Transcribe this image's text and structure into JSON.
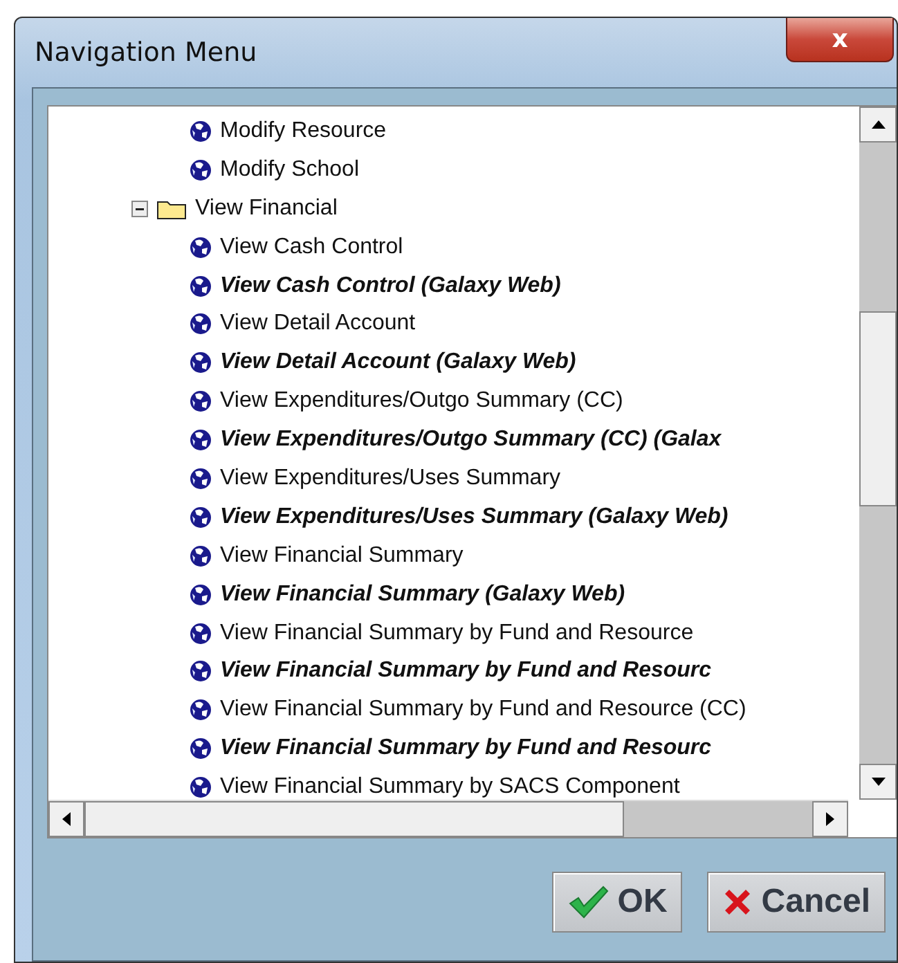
{
  "window": {
    "title": "Navigation Menu",
    "close_label": "x"
  },
  "tree": [
    {
      "children": [
        {
          "label": "Modify Resource",
          "emphasized": false
        },
        {
          "label": "Modify School",
          "emphasized": false
        }
      ]
    },
    {
      "label": "View Financial",
      "kind": "folder",
      "expanded": true,
      "children": [
        {
          "label": "View Cash Control",
          "emphasized": false
        },
        {
          "label": "View Cash Control (Galaxy Web)",
          "emphasized": true
        },
        {
          "label": "View Detail Account",
          "emphasized": false
        },
        {
          "label": "View Detail Account (Galaxy Web)",
          "emphasized": true
        },
        {
          "label": "View Expenditures/Outgo Summary (CC)",
          "emphasized": false
        },
        {
          "label": "View Expenditures/Outgo Summary (CC) (Galax",
          "emphasized": true
        },
        {
          "label": "View Expenditures/Uses Summary",
          "emphasized": false
        },
        {
          "label": "View Expenditures/Uses Summary (Galaxy Web)",
          "emphasized": true
        },
        {
          "label": "View Financial Summary",
          "emphasized": false
        },
        {
          "label": "View Financial Summary (Galaxy Web)",
          "emphasized": true
        },
        {
          "label": "View Financial Summary by Fund and Resource",
          "emphasized": false
        },
        {
          "label": "View Financial Summary by Fund and Resourc",
          "emphasized": true
        },
        {
          "label": "View Financial Summary by Fund and Resource (CC)",
          "emphasized": false
        },
        {
          "label": "View Financial Summary by Fund and Resourc",
          "emphasized": true
        },
        {
          "label": "View Financial Summary by SACS Component",
          "emphasized": false
        }
      ]
    }
  ],
  "buttons": [
    {
      "label": "OK",
      "kind": "ok"
    },
    {
      "label": "Cancel",
      "kind": "cancel"
    }
  ]
}
